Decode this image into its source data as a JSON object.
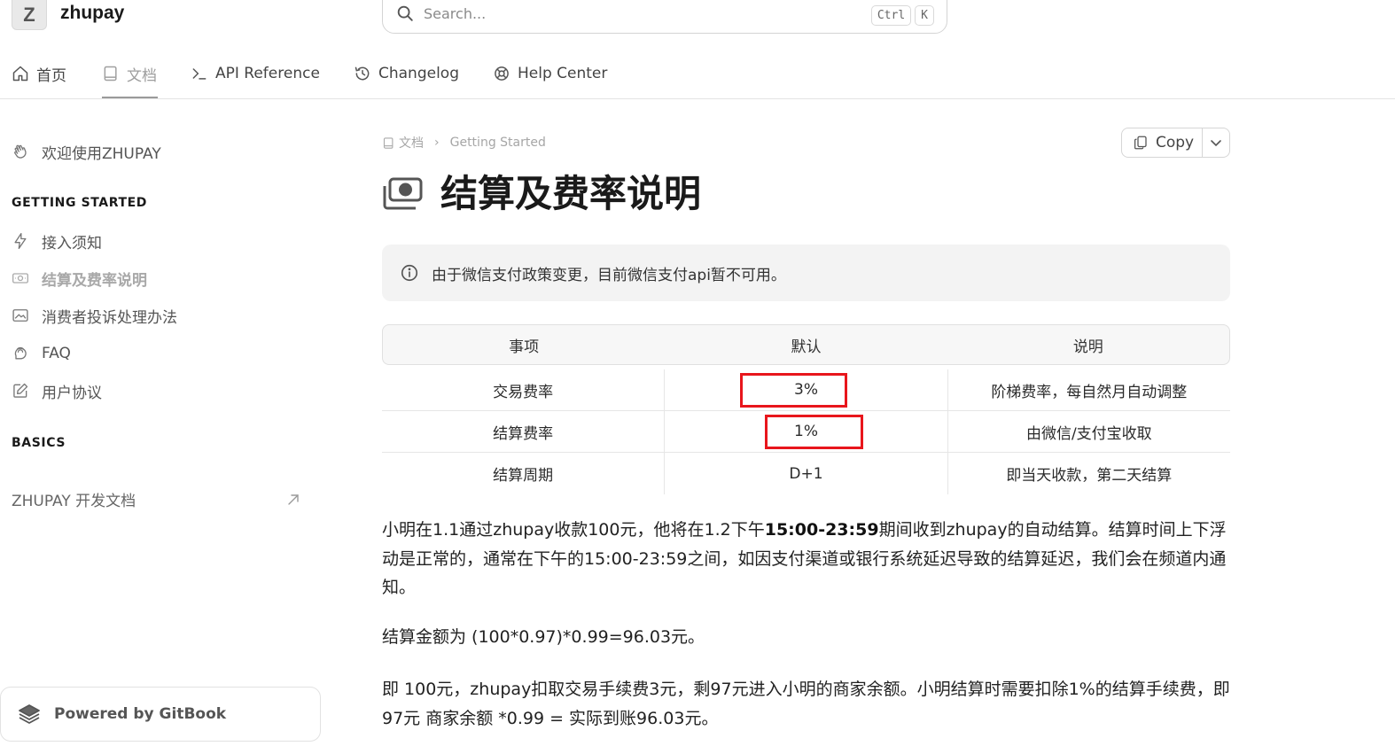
{
  "header": {
    "logo_letter": "Z",
    "site_name": "zhupay",
    "search_placeholder": "Search...",
    "shortcut_keys": [
      "Ctrl",
      "K"
    ]
  },
  "tabs": [
    {
      "label": "首页",
      "icon": "home-icon",
      "active": false
    },
    {
      "label": "文档",
      "icon": "book-icon",
      "active": true
    },
    {
      "label": "API Reference",
      "icon": "terminal-icon",
      "active": false
    },
    {
      "label": "Changelog",
      "icon": "history-icon",
      "active": false
    },
    {
      "label": "Help Center",
      "icon": "lifebuoy-icon",
      "active": false
    }
  ],
  "sidebar": {
    "welcome": {
      "label": "欢迎使用ZHUPAY",
      "icon": "wave-hand-icon"
    },
    "sections": [
      {
        "title": "GETTING STARTED",
        "items": [
          {
            "label": "接入须知",
            "icon": "bolt-icon"
          },
          {
            "label": "结算及费率说明",
            "icon": "money-icon",
            "active": true
          },
          {
            "label": "消费者投诉处理办法",
            "icon": "image-icon"
          },
          {
            "label": "FAQ",
            "icon": "speech-icon"
          },
          {
            "label": "用户协议",
            "icon": "edit-icon"
          }
        ]
      },
      {
        "title": "BASICS",
        "items": []
      }
    ],
    "external_link": "ZHUPAY 开发文档",
    "powered_by": "Powered by GitBook"
  },
  "main": {
    "breadcrumb": [
      "文档",
      "Getting Started"
    ],
    "copy_label": "Copy",
    "title": "结算及费率说明",
    "hint": "由于微信支付政策变更，目前微信支付api暂不可用。",
    "table": {
      "headers": [
        "事项",
        "默认",
        "说明"
      ],
      "rows": [
        [
          "交易费率",
          "3%",
          "阶梯费率，每自然月自动调整"
        ],
        [
          "结算费率",
          "1%",
          "由微信/支付宝收取"
        ],
        [
          "结算周期",
          "D+1",
          "即当天收款，第二天结算"
        ]
      ]
    },
    "paragraphs": {
      "p1_a": "小明在1.1通过zhupay收款100元，他将在1.2下午",
      "p1_bold": "15:00-23:59",
      "p1_b": "期间收到zhupay的自动结算。结算时间上下浮动是正常的，通常在下午的15:00-23:59之间，如因支付渠道或银行系统延迟导致的结算延迟，我们会在频道内通知。",
      "p2": "结算金额为 (100*0.97)*0.99=96.03元。",
      "p3": "即 100元，zhupay扣取交易手续费3元，剩97元进入小明的商家余额。小明结算时需要扣除1%的结算手续费，即 97元 商家余额 *0.99 = 实际到账96.03元。"
    },
    "highlight_color": "#e8161c"
  }
}
